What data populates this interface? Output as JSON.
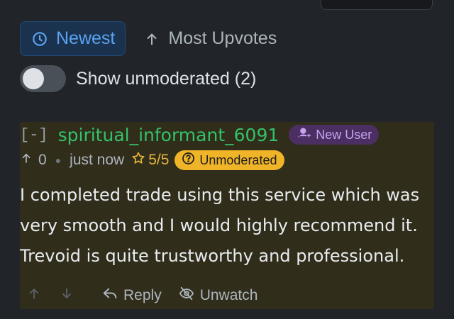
{
  "sort": {
    "newest_label": "Newest",
    "upvotes_label": "Most Upvotes"
  },
  "moderation_toggle": {
    "label": "Show unmoderated (2)",
    "state": "off"
  },
  "comment": {
    "collapse_label": "[-]",
    "username": "spiritual_informant_6091",
    "new_user_badge": "New User",
    "score": "0",
    "timestamp": "just now",
    "rating": "5/5",
    "unmoderated_badge": "Unmoderated",
    "body": "I completed trade using this service which was very smooth and I would highly recommend it. Trevoid is quite trustworthy and professional.",
    "reply_label": "Reply",
    "unwatch_label": "Unwatch"
  },
  "colors": {
    "background": "#212529",
    "accent_blue": "#5aa3f0",
    "username_green": "#33c26a",
    "new_user_purple": "#4b2f63",
    "unmoderated_yellow": "#f0b428",
    "comment_background": "#302d1b"
  },
  "icons": [
    "clock-icon",
    "arrow-up-icon",
    "user-plus-icon",
    "star-icon",
    "question-circle-icon",
    "arrow-down-icon",
    "reply-icon",
    "eye-off-icon"
  ]
}
